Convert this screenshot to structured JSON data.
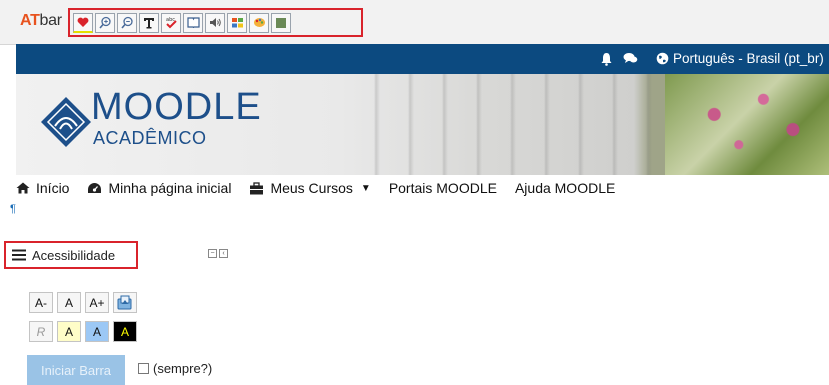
{
  "atbar": {
    "logo_at": "AT",
    "logo_bar": "bar",
    "tools": [
      {
        "icon": "heart-icon"
      },
      {
        "icon": "zoom-in-icon"
      },
      {
        "icon": "zoom-out-icon"
      },
      {
        "icon": "font-settings-icon"
      },
      {
        "icon": "spellcheck-icon"
      },
      {
        "icon": "dictionary-icon"
      },
      {
        "icon": "text-to-speech-icon"
      },
      {
        "icon": "word-prediction-icon"
      },
      {
        "icon": "color-overlay-icon"
      },
      {
        "icon": "tint-icon"
      }
    ]
  },
  "topbar": {
    "language": "Português - Brasil (pt_br)"
  },
  "banner": {
    "title": "MOODLE",
    "subtitle": "ACADÊMICO"
  },
  "nav": {
    "home": "Início",
    "dashboard": "Minha página inicial",
    "courses": "Meus Cursos",
    "portals": "Portais MOODLE",
    "help": "Ajuda MOODLE"
  },
  "pilcrow": "¶",
  "accessibility": {
    "title": "Acessibilidade",
    "size_buttons": [
      "A-",
      "A",
      "A+"
    ],
    "color_buttons": [
      "R",
      "A",
      "A",
      "A"
    ],
    "start_button": "Iniciar Barra",
    "always_label": "(sempre?)"
  },
  "colors": {
    "atbar_outline": "#d9232b",
    "navbar": "#0c4a80",
    "logo_blue": "#1d4f8a",
    "heart": "#d9232b"
  }
}
